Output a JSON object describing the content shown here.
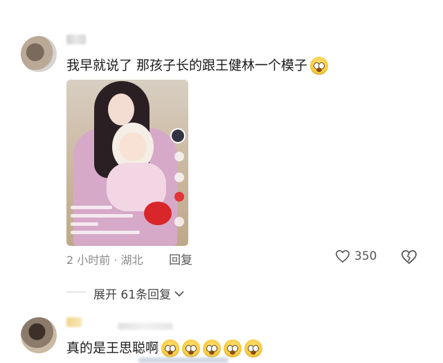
{
  "comment1": {
    "text": "我早就说了 那孩子长的跟王健林一个模子",
    "emoji_icon": "astonished-face-icon",
    "time_location": "2 小时前 · 湖北",
    "reply_label": "回复",
    "like_count": "350",
    "expand_label": "展开 61条回复"
  },
  "comment2": {
    "text": "真的是王思聪啊",
    "emoji_icon": "flushed-face-icon",
    "emoji_count": 5
  },
  "colors": {
    "text_primary": "#1a1a1a",
    "text_meta": "#8a8a8a",
    "accent_red": "#e2343a"
  }
}
